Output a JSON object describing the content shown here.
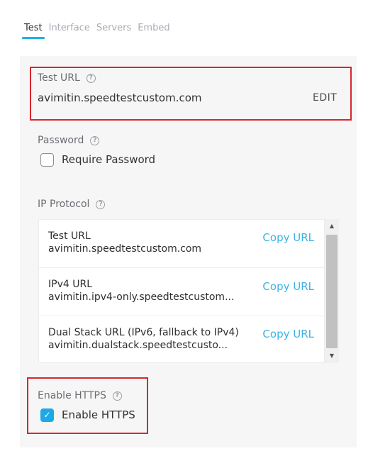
{
  "tabs": [
    {
      "label": "Test",
      "active": true
    },
    {
      "label": "Interface",
      "active": false
    },
    {
      "label": "Servers",
      "active": false
    },
    {
      "label": "Embed",
      "active": false
    }
  ],
  "test_url": {
    "label": "Test URL",
    "value": "avimitin.speedtestcustom.com",
    "edit_label": "EDIT"
  },
  "password": {
    "label": "Password",
    "checkbox_label": "Require Password",
    "checked": false
  },
  "ip_protocol": {
    "label": "IP Protocol",
    "rows": [
      {
        "title": "Test URL",
        "url": "avimitin.speedtestcustom.com",
        "action": "Copy URL"
      },
      {
        "title": "IPv4 URL",
        "url": "avimitin.ipv4-only.speedtestcustom...",
        "action": "Copy URL"
      },
      {
        "title": "Dual Stack URL (IPv6, fallback to IPv4)",
        "url": "avimitin.dualstack.speedtestcusto...",
        "action": "Copy URL"
      }
    ]
  },
  "https": {
    "label": "Enable HTTPS",
    "checkbox_label": "Enable HTTPS",
    "checked": true
  },
  "icons": {
    "help": "?",
    "check": "✓",
    "scroll_up": "▲",
    "scroll_down": "▼"
  },
  "colors": {
    "accent": "#1fb2e6",
    "highlight_border": "#d9262c",
    "link": "#39b3e3"
  }
}
